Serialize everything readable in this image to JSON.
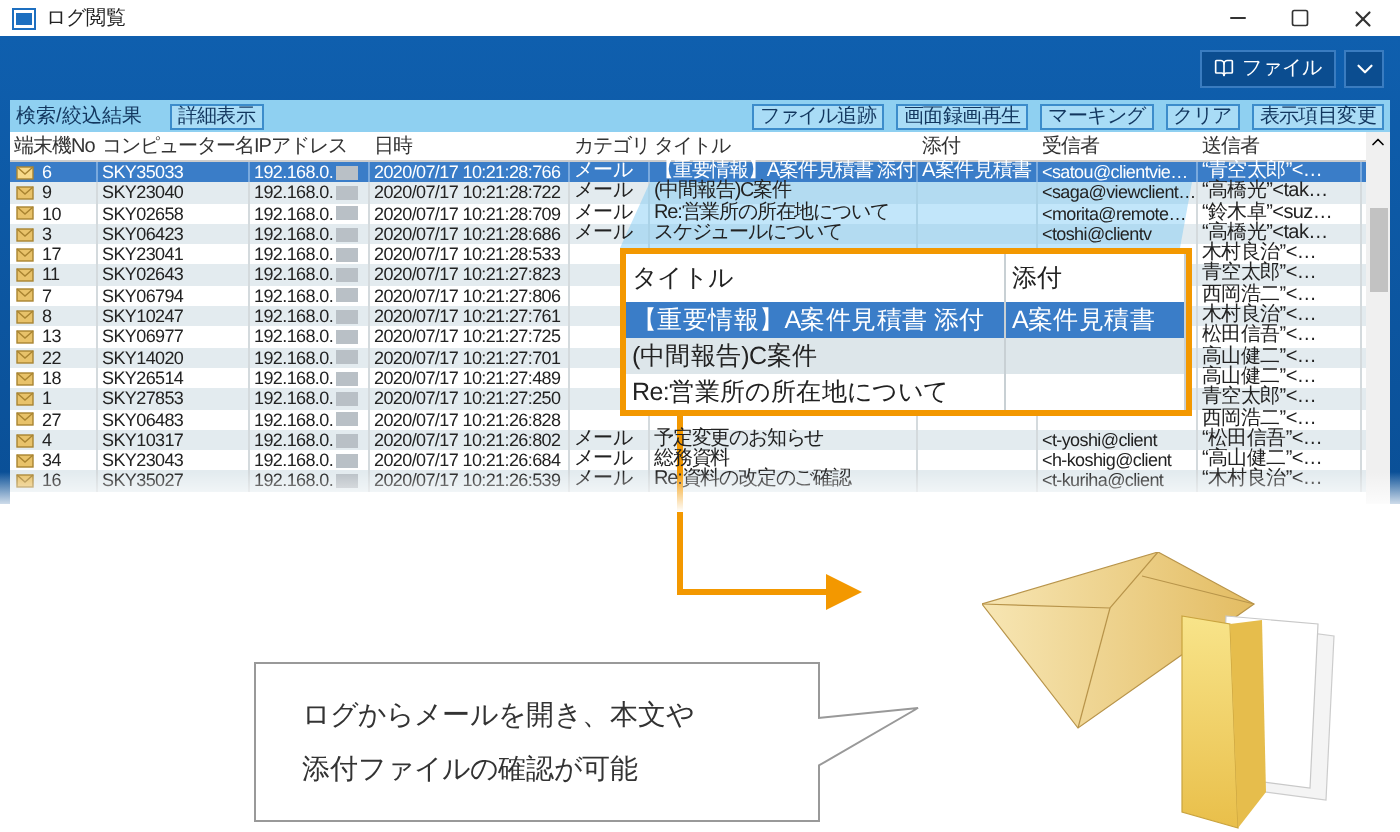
{
  "window": {
    "title": "ログ閲覧",
    "menu_button": "ファイル"
  },
  "toolbar": {
    "label": "検索/絞込結果",
    "left_buttons": [
      "詳細表示"
    ],
    "right_buttons": [
      "ファイル追跡",
      "画面録画再生",
      "マーキング",
      "クリア",
      "表示項目変更"
    ]
  },
  "table": {
    "columns": [
      "端末機No",
      "コンピューター名",
      "IPアドレス",
      "日時",
      "カテゴリ",
      "タイトル",
      "添付",
      "受信者",
      "送信者"
    ],
    "rows": [
      {
        "no": "6",
        "pc": "SKY35033",
        "ip": "192.168.0.",
        "time": "2020/07/17 10:21:28:766",
        "category": "メール",
        "title": "【重要情報】A案件見積書 添付",
        "attachment": "A案件見積書",
        "to": "<satou@clientvie…",
        "from": "“青空太郎”<…",
        "selected": true
      },
      {
        "no": "9",
        "pc": "SKY23040",
        "ip": "192.168.0.",
        "time": "2020/07/17 10:21:28:722",
        "category": "メール",
        "title": "(中間報告)C案件",
        "to": "<saga@viewclient…",
        "from": "“高橋光”<tak…",
        "selected": false
      },
      {
        "no": "10",
        "pc": "SKY02658",
        "ip": "192.168.0.",
        "time": "2020/07/17 10:21:28:709",
        "category": "メール",
        "title": "Re:営業所の所在地について",
        "to": "<morita@remote…",
        "from": "“鈴木卓”<suz…",
        "selected": false
      },
      {
        "no": "3",
        "pc": "SKY06423",
        "ip": "192.168.0.",
        "time": "2020/07/17 10:21:28:686",
        "category": "メール",
        "title": "スケジュールについて",
        "to": "<toshi@clientv",
        "from": "“高橋光”<tak…",
        "selected": false
      },
      {
        "no": "17",
        "pc": "SKY23041",
        "ip": "192.168.0.",
        "time": "2020/07/17 10:21:28:533",
        "from": "木村良治”<…",
        "selected": false
      },
      {
        "no": "11",
        "pc": "SKY02643",
        "ip": "192.168.0.",
        "time": "2020/07/17 10:21:27:823",
        "from": "青空太郎”<…",
        "selected": false
      },
      {
        "no": "7",
        "pc": "SKY06794",
        "ip": "192.168.0.",
        "time": "2020/07/17 10:21:27:806",
        "from": "西岡浩二”<…",
        "selected": false
      },
      {
        "no": "8",
        "pc": "SKY10247",
        "ip": "192.168.0.",
        "time": "2020/07/17 10:21:27:761",
        "from": "木村良治”<…",
        "selected": false
      },
      {
        "no": "13",
        "pc": "SKY06977",
        "ip": "192.168.0.",
        "time": "2020/07/17 10:21:27:725",
        "from": "松田信吾”<…",
        "selected": false
      },
      {
        "no": "22",
        "pc": "SKY14020",
        "ip": "192.168.0.",
        "time": "2020/07/17 10:21:27:701",
        "from": "高山健二”<…",
        "selected": false
      },
      {
        "no": "18",
        "pc": "SKY26514",
        "ip": "192.168.0.",
        "time": "2020/07/17 10:21:27:489",
        "from": "高山健二”<…",
        "selected": false
      },
      {
        "no": "1",
        "pc": "SKY27853",
        "ip": "192.168.0.",
        "time": "2020/07/17 10:21:27:250",
        "from": "青空太郎”<…",
        "selected": false
      },
      {
        "no": "27",
        "pc": "SKY06483",
        "ip": "192.168.0.",
        "time": "2020/07/17 10:21:26:828",
        "from": "西岡浩二”<…",
        "selected": false
      },
      {
        "no": "4",
        "pc": "SKY10317",
        "ip": "192.168.0.",
        "time": "2020/07/17 10:21:26:802",
        "category": "メール",
        "title": "予定変更のお知らせ",
        "to": "<t-yoshi@client",
        "from": "“松田信吾”<…",
        "selected": false
      },
      {
        "no": "34",
        "pc": "SKY23043",
        "ip": "192.168.0.",
        "time": "2020/07/17 10:21:26:684",
        "category": "メール",
        "title": "総務資料",
        "to": "<h-koshig@client",
        "from": "“高山健二”<…",
        "selected": false
      },
      {
        "no": "16",
        "pc": "SKY35027",
        "ip": "192.168.0.",
        "time": "2020/07/17 10:21:26:539",
        "category": "メール",
        "title": "Re:資料の改定のご確認",
        "to": "<t-kuriha@client",
        "from": "“木村良治”<…",
        "selected": false
      }
    ]
  },
  "zoom_panel": {
    "columns": [
      "タイトル",
      "添付"
    ],
    "rows": [
      {
        "title": "【重要情報】A案件見積書 添付",
        "attachment": "A案件見積書",
        "selected": true
      },
      {
        "title": "(中間報告)C案件",
        "selected": false
      },
      {
        "title": "Re:営業所の所在地について",
        "selected": false
      }
    ]
  },
  "callout": {
    "text": "ログからメールを開き、本文や添付ファイルの確認が可能"
  }
}
